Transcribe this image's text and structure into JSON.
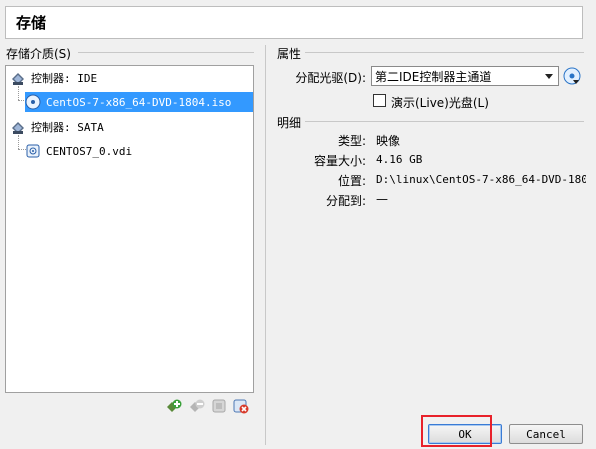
{
  "header": {
    "title": "存储"
  },
  "storage": {
    "label": "存储介质(S)",
    "items": [
      {
        "label": "控制器: IDE",
        "type": "controller"
      },
      {
        "label": "CentOS-7-x86_64-DVD-1804.iso",
        "type": "optical",
        "selected": true
      },
      {
        "label": "控制器: SATA",
        "type": "controller"
      },
      {
        "label": "CENTOS7_0.vdi",
        "type": "disk"
      }
    ]
  },
  "properties": {
    "label": "属性",
    "drive_label": "分配光驱(D):",
    "drive_value": "第二IDE控制器主通道",
    "live_cd_label": "演示(Live)光盘(L)",
    "live_cd_checked": false
  },
  "details": {
    "label": "明细",
    "rows": [
      {
        "label": "类型:",
        "value": "映像"
      },
      {
        "label": "容量大小:",
        "value": "4.16  GB"
      },
      {
        "label": "位置:",
        "value": "D:\\linux\\CentOS-7-x86_64-DVD-180…"
      },
      {
        "label": "分配到:",
        "value": "—"
      }
    ]
  },
  "buttons": {
    "ok": "OK",
    "cancel": "Cancel"
  },
  "colors": {
    "selection": "#3399ff",
    "highlight": "#e8212a"
  }
}
